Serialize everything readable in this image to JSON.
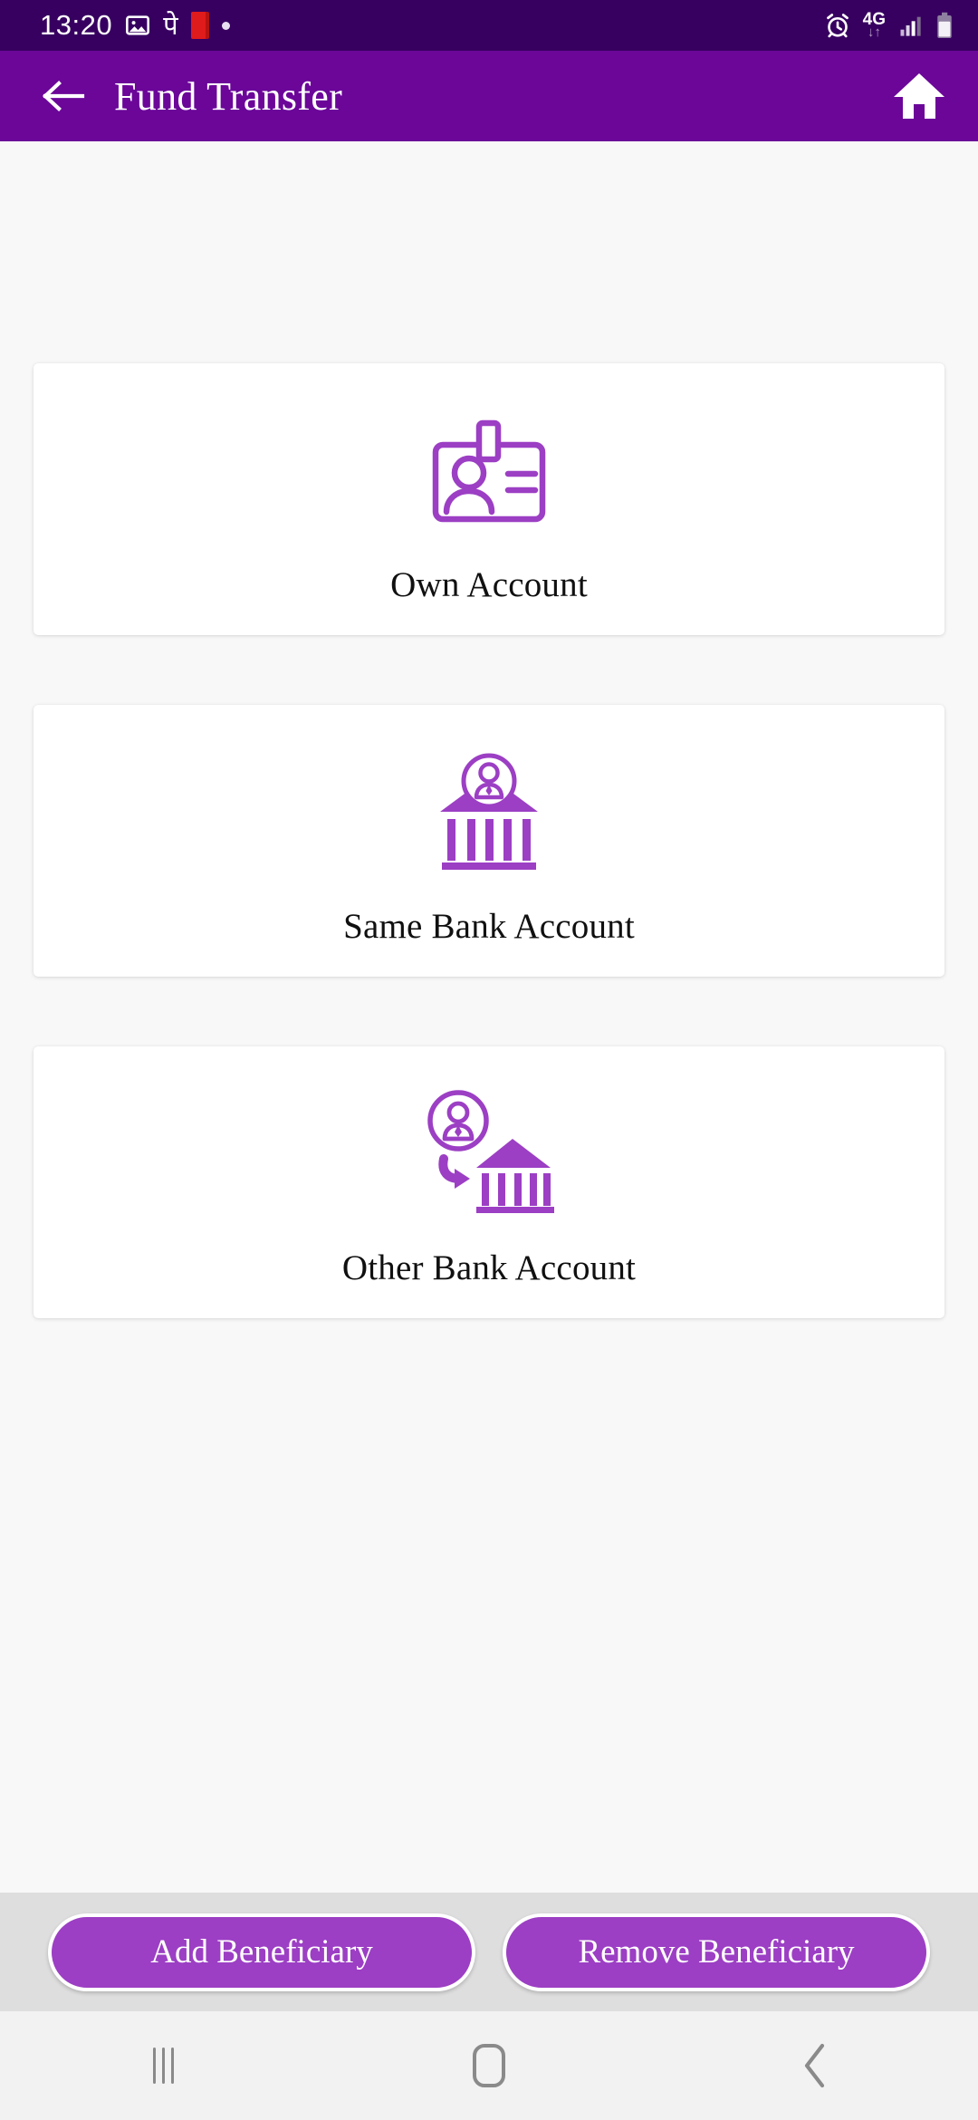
{
  "status_bar": {
    "time": "13:20",
    "left_icons": [
      {
        "name": "gallery-image-icon",
        "glyph": "image"
      },
      {
        "name": "phonepe-icon",
        "glyph": "पे"
      },
      {
        "name": "red-book-icon",
        "glyph": "book"
      },
      {
        "name": "notification-dot-icon",
        "glyph": "dot"
      }
    ],
    "alarm_icon": "alarm-clock-icon",
    "network_type": "4G",
    "data_arrows": "↓↑",
    "signal_icon": "signal-bars-icon",
    "battery_icon": "battery-icon",
    "background_color": "#370060"
  },
  "app_bar": {
    "back_icon": "back-arrow-icon",
    "title": "Fund Transfer",
    "home_icon": "home-icon",
    "background_color": "#6b0699",
    "text_color": "#ffffff"
  },
  "main": {
    "accent_color": "#9c3fc4",
    "background_color": "#f8f8f8",
    "options": [
      {
        "id": "own-account",
        "label": "Own Account",
        "icon": "id-card-icon"
      },
      {
        "id": "same-bank-account",
        "label": "Same Bank Account",
        "icon": "bank-person-icon"
      },
      {
        "id": "other-bank-account",
        "label": "Other Bank Account",
        "icon": "transfer-to-bank-icon"
      }
    ]
  },
  "action_bar": {
    "background_color": "#dedede",
    "buttons": [
      {
        "id": "add-beneficiary",
        "label": "Add Beneficiary"
      },
      {
        "id": "remove-beneficiary",
        "label": "Remove Beneficiary"
      }
    ]
  },
  "nav_bar": {
    "background_color": "#f2f2f2",
    "buttons": [
      {
        "id": "recents",
        "icon": "recents-icon"
      },
      {
        "id": "home",
        "icon": "home-square-icon"
      },
      {
        "id": "back",
        "icon": "back-chevron-icon"
      }
    ]
  }
}
